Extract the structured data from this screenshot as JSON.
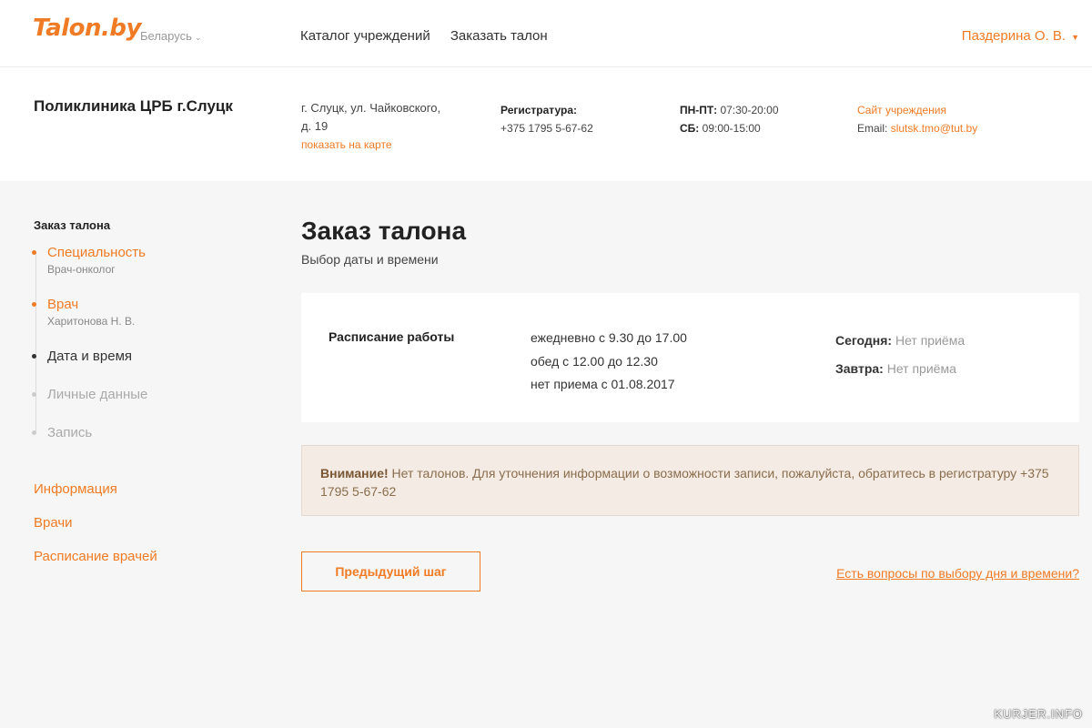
{
  "header": {
    "logo": "Talon.by",
    "country": "Беларусь",
    "nav": [
      "Каталог учреждений",
      "Заказать талон"
    ],
    "user": "Паздерина О. В."
  },
  "institution": {
    "name": "Поликлиника ЦРБ г.Слуцк",
    "address_line1": "г. Слуцк, ул. Чайковского,",
    "address_line2": "д. 19",
    "map_link": "показать на карте",
    "reg_label": "Регистратура:",
    "reg_phone": "+375 1795 5-67-62",
    "hours_weekdays_label": "ПН-ПТ:",
    "hours_weekdays": "07:30-20:00",
    "hours_sat_label": "СБ:",
    "hours_sat": "09:00-15:00",
    "site_link": "Сайт учреждения",
    "email_label": "Email:",
    "email": "slutsk.tmo@tut.by"
  },
  "sidebar": {
    "title": "Заказ талона",
    "steps": [
      {
        "label": "Специальность",
        "sub": "Врач-онколог"
      },
      {
        "label": "Врач",
        "sub": "Харитонова Н. В."
      },
      {
        "label": "Дата и время"
      },
      {
        "label": "Личные данные"
      },
      {
        "label": "Запись"
      }
    ],
    "links": [
      "Информация",
      "Врачи",
      "Расписание врачей"
    ]
  },
  "main": {
    "title": "Заказ талона",
    "subtitle": "Выбор даты и времени",
    "schedule_label": "Расписание работы",
    "schedule": [
      "ежедневно с 9.30 до 17.00",
      "обед с 12.00 до 12.30",
      "нет приема с 01.08.2017"
    ],
    "today_label": "Сегодня:",
    "today_value": "Нет приёма",
    "tomorrow_label": "Завтра:",
    "tomorrow_value": "Нет приёма",
    "alert_strong": "Внимание!",
    "alert_text": " Нет талонов. Для уточнения информации о возможности записи, пожалуйста, обратитесь в регистратуру +375 1795 5-67-62",
    "prev_button": "Предыдущий шаг",
    "question_link": "Есть вопросы по выбору дня и времени?"
  },
  "watermark": "KURJER.INFO",
  "colors": {
    "accent": "#f07b24"
  }
}
